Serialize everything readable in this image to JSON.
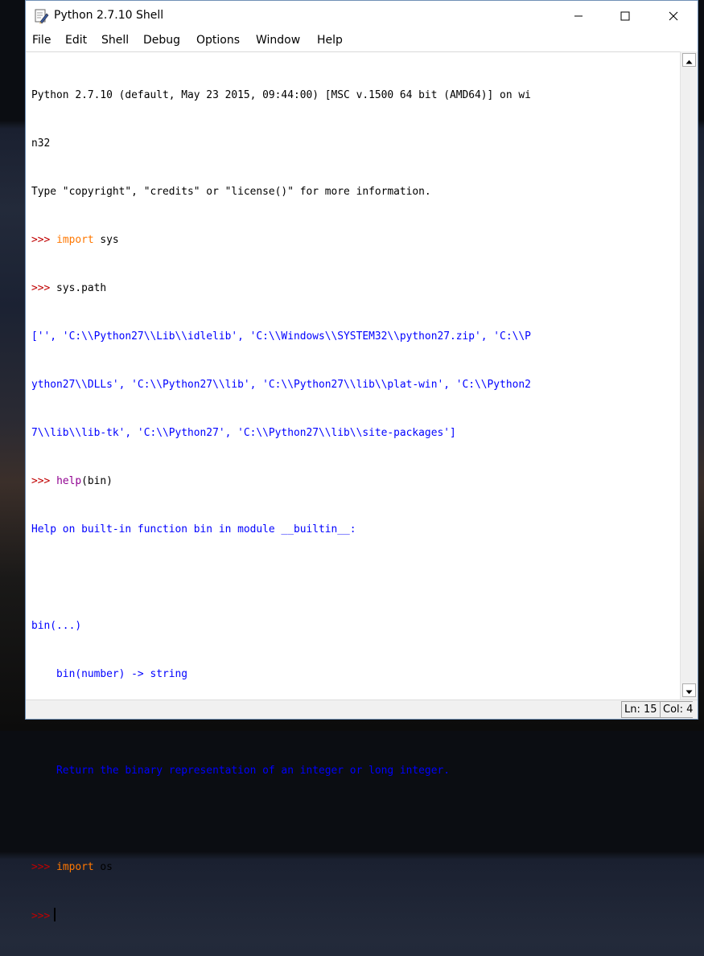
{
  "window": {
    "title": "Python 2.7.10 Shell",
    "controls": {
      "minimize": "minimize-icon",
      "maximize": "maximize-icon",
      "close": "close-icon"
    }
  },
  "menu": [
    "File",
    "Edit",
    "Shell",
    "Debug",
    "Options",
    "Window",
    "Help"
  ],
  "shell": {
    "banner_1": "Python 2.7.10 (default, May 23 2015, 09:44:00) [MSC v.1500 64 bit (AMD64)] on wi",
    "banner_2": "n32",
    "banner_3": "Type \"copyright\", \"credits\" or \"license()\" for more information.",
    "prompt": ">>>",
    "cmd_1_kw": "import",
    "cmd_1_rest": " sys",
    "cmd_2": " sys.path",
    "out_path_1": "['', 'C:\\\\Python27\\\\Lib\\\\idlelib', 'C:\\\\Windows\\\\SYSTEM32\\\\python27.zip', 'C:\\\\P",
    "out_path_2": "ython27\\\\DLLs', 'C:\\\\Python27\\\\lib', 'C:\\\\Python27\\\\lib\\\\plat-win', 'C:\\\\Python2",
    "out_path_3": "7\\\\lib\\\\lib-tk', 'C:\\\\Python27', 'C:\\\\Python27\\\\lib\\\\site-packages']",
    "cmd_3_bi": "help",
    "cmd_3_rest": "(bin)",
    "help_1": "Help on built-in function bin in module __builtin__:",
    "help_2": "bin(...)",
    "help_3": "    bin(number) -> string",
    "help_4": "    Return the binary representation of an integer or long integer.",
    "cmd_4_kw": "import",
    "cmd_4_rest": " os"
  },
  "status": {
    "line": "Ln: 15",
    "col": "Col: 4"
  },
  "colors": {
    "prompt": "#c00000",
    "keyword": "#ff7700",
    "builtin": "#900090",
    "output": "#0000ff"
  }
}
